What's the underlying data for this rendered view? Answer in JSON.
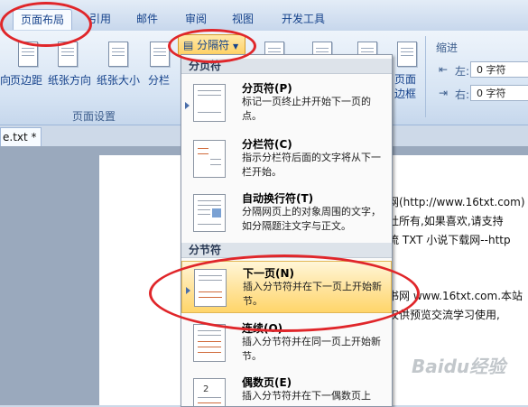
{
  "tabs": [
    {
      "label": "页面布局",
      "active": true
    },
    {
      "label": "引用"
    },
    {
      "label": "邮件"
    },
    {
      "label": "审阅"
    },
    {
      "label": "视图"
    },
    {
      "label": "开发工具"
    }
  ],
  "ribbon": {
    "breaks_button": "分隔符",
    "buttons": [
      "页边距",
      "纸张方向",
      "纸张大小",
      "分栏"
    ],
    "partial_left": "向",
    "page_border": "页面边框",
    "group_label": "页面设置",
    "indent": {
      "title": "缩进",
      "left_label": "左:",
      "left_value": "0 字符",
      "right_label": "右:",
      "right_value": "0 字符"
    }
  },
  "document": {
    "tab_label": "e.txt *",
    "lines": [
      "网(http://www.16txt.com)",
      "社所有,如果喜欢,请支持",
      "流 TXT 小说下载网--http",
      "书网 www.16txt.com.本站",
      "仅供预览交流学习使用,"
    ]
  },
  "menu": {
    "page_breaks_header": "分页符",
    "section_breaks_header": "分节符",
    "items": [
      {
        "title": "分页符(P)",
        "desc": "标记一页终止并开始下一页的点。"
      },
      {
        "title": "分栏符(C)",
        "desc": "指示分栏符后面的文字将从下一栏开始。"
      },
      {
        "title": "自动换行符(T)",
        "desc": "分隔网页上的对象周围的文字，如分隔题注文字与正文。"
      },
      {
        "title": "下一页(N)",
        "desc": "插入分节符并在下一页上开始新节。"
      },
      {
        "title": "连续(O)",
        "desc": "插入分节符并在同一页上开始新节。"
      },
      {
        "title": "偶数页(E)",
        "desc": "插入分节符并在下一偶数页上"
      }
    ]
  },
  "watermark": "Baidu经验",
  "colors": {
    "highlight": "#ffd56a",
    "annotation": "#e0262a",
    "ribbon": "#d5e3f3"
  }
}
